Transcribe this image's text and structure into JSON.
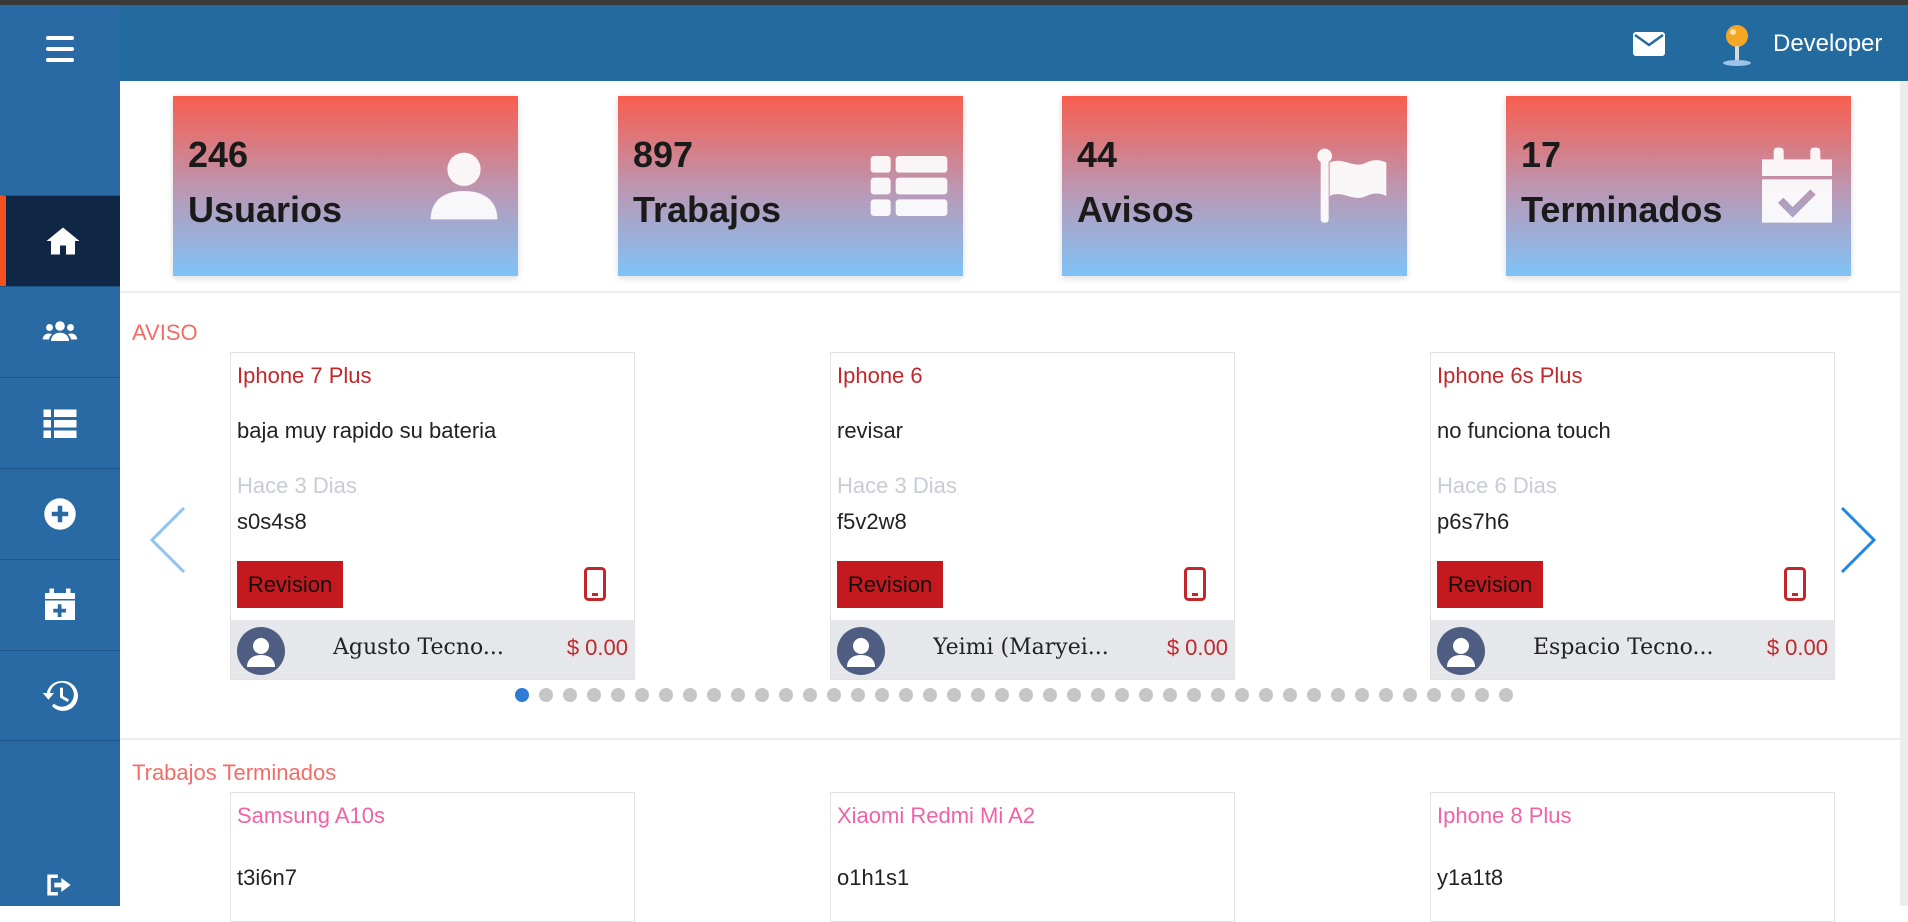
{
  "header": {
    "user_name": "Developer"
  },
  "nav": {
    "items": [
      "home",
      "users",
      "list",
      "add",
      "calendar",
      "history"
    ],
    "active": "home"
  },
  "stats": [
    {
      "count": "246",
      "label": "Usuarios",
      "icon": "user-icon"
    },
    {
      "count": "897",
      "label": "Trabajos",
      "icon": "list-icon"
    },
    {
      "count": "44",
      "label": "Avisos",
      "icon": "flag-icon"
    },
    {
      "count": "17",
      "label": "Terminados",
      "icon": "calendar-check-icon"
    }
  ],
  "aviso": {
    "title": "AVISO",
    "cards": [
      {
        "device": "Iphone 7 Plus",
        "description": "baja muy rapido su bateria",
        "time": "Hace 3 Dias",
        "code": "s0s4s8",
        "status": "Revision",
        "client": "Agusto Tecno...",
        "price": "$ 0.00"
      },
      {
        "device": "Iphone 6",
        "description": "revisar",
        "time": "Hace 3 Dias",
        "code": "f5v2w8",
        "status": "Revision",
        "client": "Yeimi (Maryei...",
        "price": "$ 0.00"
      },
      {
        "device": "Iphone 6s Plus",
        "description": "no funciona touch",
        "time": "Hace 6 Dias",
        "code": "p6s7h6",
        "status": "Revision",
        "client": "Espacio Tecno...",
        "price": "$ 0.00"
      }
    ],
    "carousel_pages": 42,
    "carousel_active": 1
  },
  "terminados": {
    "title": "Trabajos Terminados",
    "cards": [
      {
        "device": "Samsung A10s",
        "code": "t3i6n7"
      },
      {
        "device": "Xiaomi Redmi Mi A2",
        "code": "o1h1s1"
      },
      {
        "device": "Iphone 8 Plus",
        "code": "y1a1t8"
      }
    ]
  },
  "colors": {
    "sidebar": "#2a6aa4",
    "header": "#236b9e",
    "active_nav": "#0f2744",
    "accent": "#f4511e",
    "badge": "#c3191f",
    "title_red": "#c3272b",
    "title_pink": "#f062a8"
  }
}
